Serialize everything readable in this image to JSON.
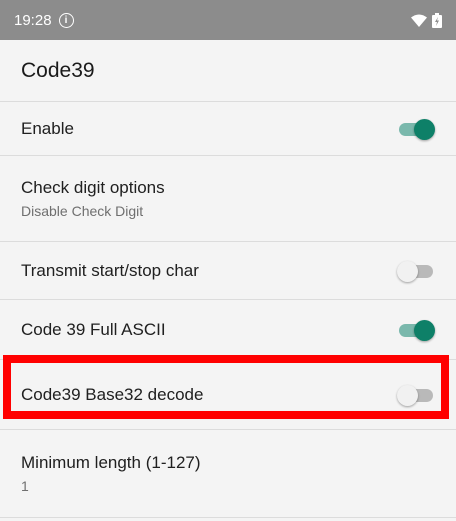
{
  "status_bar": {
    "time": "19:28",
    "info_icon": "info-circle-icon",
    "wifi_icon": "wifi-icon",
    "battery_icon": "battery-charging-icon"
  },
  "app_bar": {
    "title": "Code39"
  },
  "settings": [
    {
      "title": "Enable",
      "toggle": true
    },
    {
      "title": "Check digit options",
      "summary": "Disable Check Digit"
    },
    {
      "title": "Transmit start/stop char",
      "toggle": false
    },
    {
      "title": "Code 39 Full ASCII",
      "toggle": true
    },
    {
      "title": "Code39 Base32 decode",
      "toggle": false,
      "highlighted": true
    },
    {
      "title": "Minimum length (1-127)",
      "summary": "1"
    }
  ],
  "colors": {
    "accent": "#0e8068",
    "highlight": "#ff0000",
    "status_bar": "#8c8c8c"
  }
}
